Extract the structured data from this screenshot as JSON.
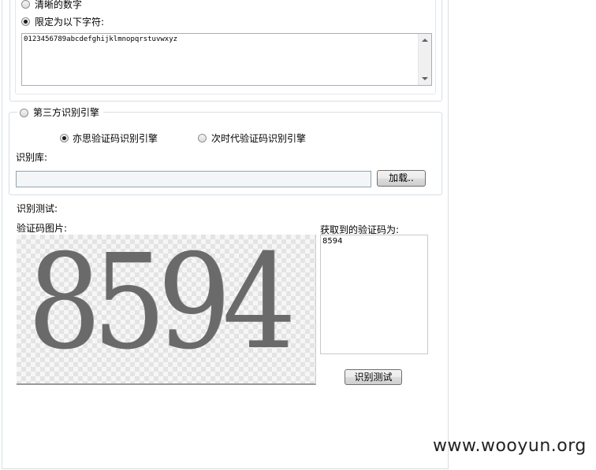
{
  "top_group": {
    "options": {
      "clear_digits": "清晰的数字",
      "limit_chars": "限定为以下字符:"
    },
    "chars_value": "0123456789abcdefghijklmnopqrstuvwxyz"
  },
  "third_party": {
    "label": "第三方识别引擎",
    "engine_yisi": "亦思验证码识别引擎",
    "engine_next": "次时代验证码识别引擎",
    "library_label": "识别库:",
    "library_value": "",
    "load_button": "加载.."
  },
  "test": {
    "label": "识别测试:",
    "image_label": "验证码图片:",
    "captcha_text": "8594",
    "result_label": "获取到的验证码为:",
    "result_value": "8594",
    "test_button": "识别测试"
  },
  "watermark": "www.wooyun.org",
  "selection": {
    "limit_chars_checked": true,
    "third_party_checked": false,
    "engine_yisi_checked": true
  }
}
